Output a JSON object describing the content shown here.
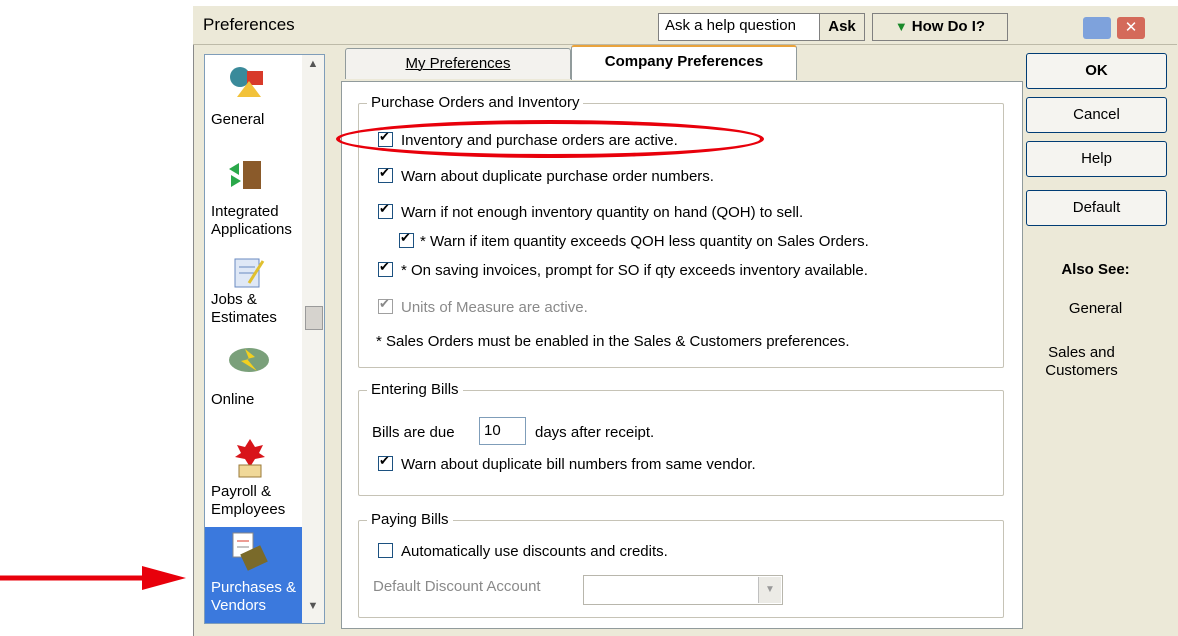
{
  "window": {
    "title": "Preferences",
    "help_prompt": "Ask a help question",
    "ask_label": "Ask",
    "howdoi_label": "How Do I?"
  },
  "sidebar": {
    "items": [
      {
        "label": "General",
        "icon": "general-icon"
      },
      {
        "label": "Integrated Applications",
        "icon": "integrated-applications-icon"
      },
      {
        "label": "Jobs & Estimates",
        "icon": "jobs-estimates-icon"
      },
      {
        "label": "Online",
        "icon": "online-icon"
      },
      {
        "label": "Payroll & Employees",
        "icon": "payroll-employees-icon"
      },
      {
        "label": "Purchases & Vendors",
        "icon": "purchases-vendors-icon",
        "selected": true
      }
    ]
  },
  "tabs": [
    {
      "label": "My Preferences",
      "active": false
    },
    {
      "label": "Company Preferences",
      "active": true
    }
  ],
  "purchase_orders": {
    "title": "Purchase Orders and Inventory",
    "inventory_active": "Inventory and purchase orders are active.",
    "warn_duplicate_po": "Warn about duplicate purchase order numbers.",
    "warn_qoh": "Warn if not enough inventory quantity on hand (QOH) to sell.",
    "warn_item_qoh": "* Warn if item quantity exceeds QOH less quantity on Sales Orders.",
    "prompt_so": "* On saving invoices, prompt for SO if qty exceeds inventory available.",
    "units_of_measure": "Units of Measure are active.",
    "note": "* Sales Orders must be enabled in the Sales & Customers preferences."
  },
  "entering_bills": {
    "title": "Entering Bills",
    "due_prefix": "Bills are due",
    "due_days": "10",
    "due_suffix": "days after receipt.",
    "warn_duplicate_bill": "Warn about duplicate bill numbers from same vendor."
  },
  "paying_bills": {
    "title": "Paying Bills",
    "auto_discounts": "Automatically use discounts and credits.",
    "discount_account_label": "Default Discount Account",
    "discount_account_value": ""
  },
  "buttons": {
    "ok": "OK",
    "cancel": "Cancel",
    "help": "Help",
    "default": "Default"
  },
  "also_see": {
    "title": "Also See:",
    "links": [
      "General",
      "Sales and Customers"
    ]
  },
  "colors": {
    "annotation_red": "#e8000b",
    "selected_blue": "#3b79dd"
  }
}
